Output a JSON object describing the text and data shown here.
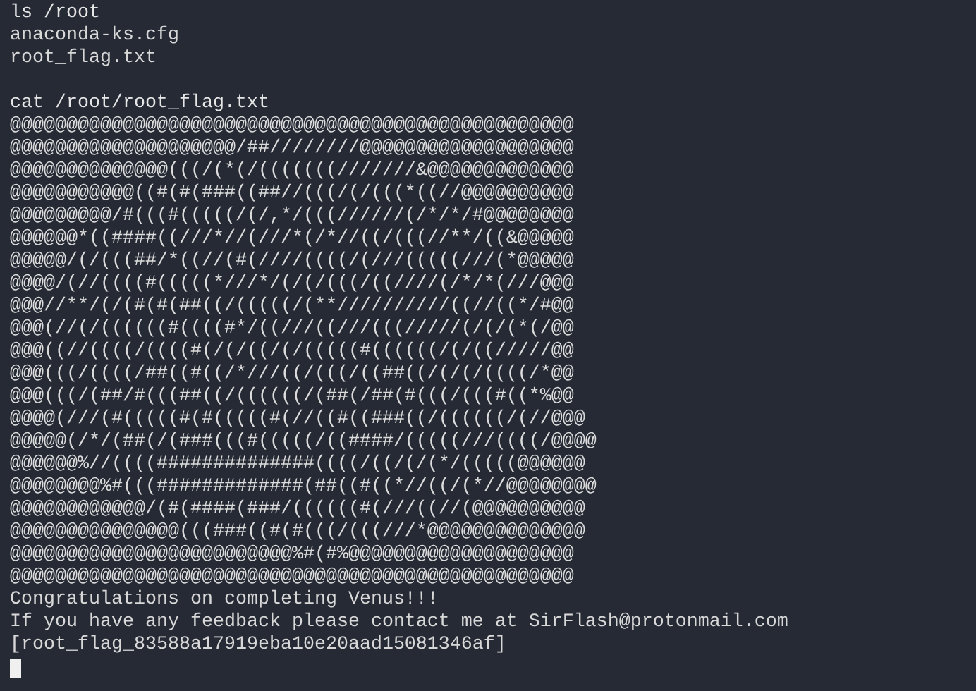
{
  "terminal": {
    "blocks": [
      {
        "lines": [
          {
            "kind": "command",
            "text": "ls /root"
          },
          {
            "kind": "output",
            "text": "anaconda-ks.cfg"
          },
          {
            "kind": "output",
            "text": "root_flag.txt"
          }
        ]
      },
      {
        "lines": [
          {
            "kind": "command",
            "text": "cat /root/root_flag.txt"
          },
          {
            "kind": "art",
            "text": "@@@@@@@@@@@@@@@@@@@@@@@@@@@@@@@@@@@@@@@@@@@@@@@@@@"
          },
          {
            "kind": "art",
            "text": "@@@@@@@@@@@@@@@@@@@@/##////////@@@@@@@@@@@@@@@@@@@"
          },
          {
            "kind": "art",
            "text": "@@@@@@@@@@@@@@(((/(*(/(((((((///////&@@@@@@@@@@@@@"
          },
          {
            "kind": "art",
            "text": "@@@@@@@@@@@((#(#(###((##//(((/(/(((*((//@@@@@@@@@@"
          },
          {
            "kind": "art",
            "text": "@@@@@@@@@/#(((#(((((/(/,*/(((//////(/*/*/#@@@@@@@@"
          },
          {
            "kind": "art",
            "text": "@@@@@@*((####((///*//(///*(/*//((/(((//**/((&@@@@@"
          },
          {
            "kind": "art",
            "text": "@@@@@/(/(((##/*((//(#(////((((/(///(((((///(*@@@@@"
          },
          {
            "kind": "art",
            "text": "@@@@/(//((((#(((((*///*/(/(/(((/((////(/*/*(///@@@"
          },
          {
            "kind": "art",
            "text": "@@@//**/(/(#(#(##((/(((((/(**//////////((//((*/#@@"
          },
          {
            "kind": "art",
            "text": "@@@(//(/((((((#((((#*/((///((///(((/////(/(/(*(/@@"
          },
          {
            "kind": "art",
            "text": "@@@((//((((/((((#(/(/((/(/(((((#((((((/(/((/////@@"
          },
          {
            "kind": "art",
            "text": "@@@(((/((((/##((#((/*///((/(((/((##((/(/(/((((/*@@"
          },
          {
            "kind": "art",
            "text": "@@@(((/(##/#(((##((/((((((/(##(/##(#(((/(((#((*%@@"
          },
          {
            "kind": "art",
            "text": "@@@@(///(#(((((#(#(((((#(//((#((###((/((((((/(//@@@"
          },
          {
            "kind": "art",
            "text": "@@@@@(/*/(##(/(###(((#(((((/((####/(((((///((((/@@@@"
          },
          {
            "kind": "art",
            "text": "@@@@@@%//((((##############((((/((/(/(*/(((((@@@@@@"
          },
          {
            "kind": "art",
            "text": "@@@@@@@@%#(((#############(##((#((*//((/(*//@@@@@@@@"
          },
          {
            "kind": "art",
            "text": "@@@@@@@@@@@@/(#(####(###/((((((#(///((//(@@@@@@@@@@"
          },
          {
            "kind": "art",
            "text": "@@@@@@@@@@@@@@@(((###((#(#(((/(((///*@@@@@@@@@@@@@@"
          },
          {
            "kind": "art",
            "text": "@@@@@@@@@@@@@@@@@@@@@@@@@%#(#%@@@@@@@@@@@@@@@@@@@@"
          },
          {
            "kind": "art",
            "text": "@@@@@@@@@@@@@@@@@@@@@@@@@@@@@@@@@@@@@@@@@@@@@@@@@@"
          },
          {
            "kind": "output",
            "text": "Congratulations on completing Venus!!!"
          },
          {
            "kind": "output",
            "text": "If you have any feedback please contact me at SirFlash@protonmail.com"
          },
          {
            "kind": "output",
            "text": "[root_flag_83588a17919eba10e20aad15081346af]"
          }
        ]
      }
    ],
    "cursor_visible": true
  }
}
